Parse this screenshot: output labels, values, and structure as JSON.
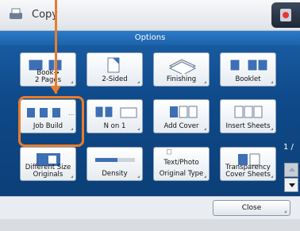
{
  "title": {
    "app": "Copy"
  },
  "header": {
    "options": "Options"
  },
  "tiles": [
    {
      "label": "Book→\n2 Pages",
      "name": "tile-book-2-pages"
    },
    {
      "label": "2-Sided",
      "name": "tile-2-sided"
    },
    {
      "label": "Finishing",
      "name": "tile-finishing"
    },
    {
      "label": "Booklet",
      "name": "tile-booklet"
    },
    {
      "label": "Job Build",
      "name": "tile-job-build"
    },
    {
      "label": "N on 1",
      "name": "tile-n-on-1"
    },
    {
      "label": "Add Cover",
      "name": "tile-add-cover"
    },
    {
      "label": "Insert Sheets",
      "name": "tile-insert-sheets"
    },
    {
      "label": "Different Size\nOriginals",
      "name": "tile-different-size-originals"
    },
    {
      "label": "Density",
      "name": "tile-density"
    },
    {
      "label": "Original Type",
      "name": "tile-original-type"
    },
    {
      "label": "Transparency\nCover Sheets",
      "name": "tile-transparency-cover-sheets"
    }
  ],
  "texts": {
    "original_type_top": "Text/Photo"
  },
  "pager": {
    "indicator": "1 /"
  },
  "footer": {
    "close": "Close"
  },
  "colors": {
    "accent": "#e77d2c",
    "panel": "#0f4a8a"
  }
}
